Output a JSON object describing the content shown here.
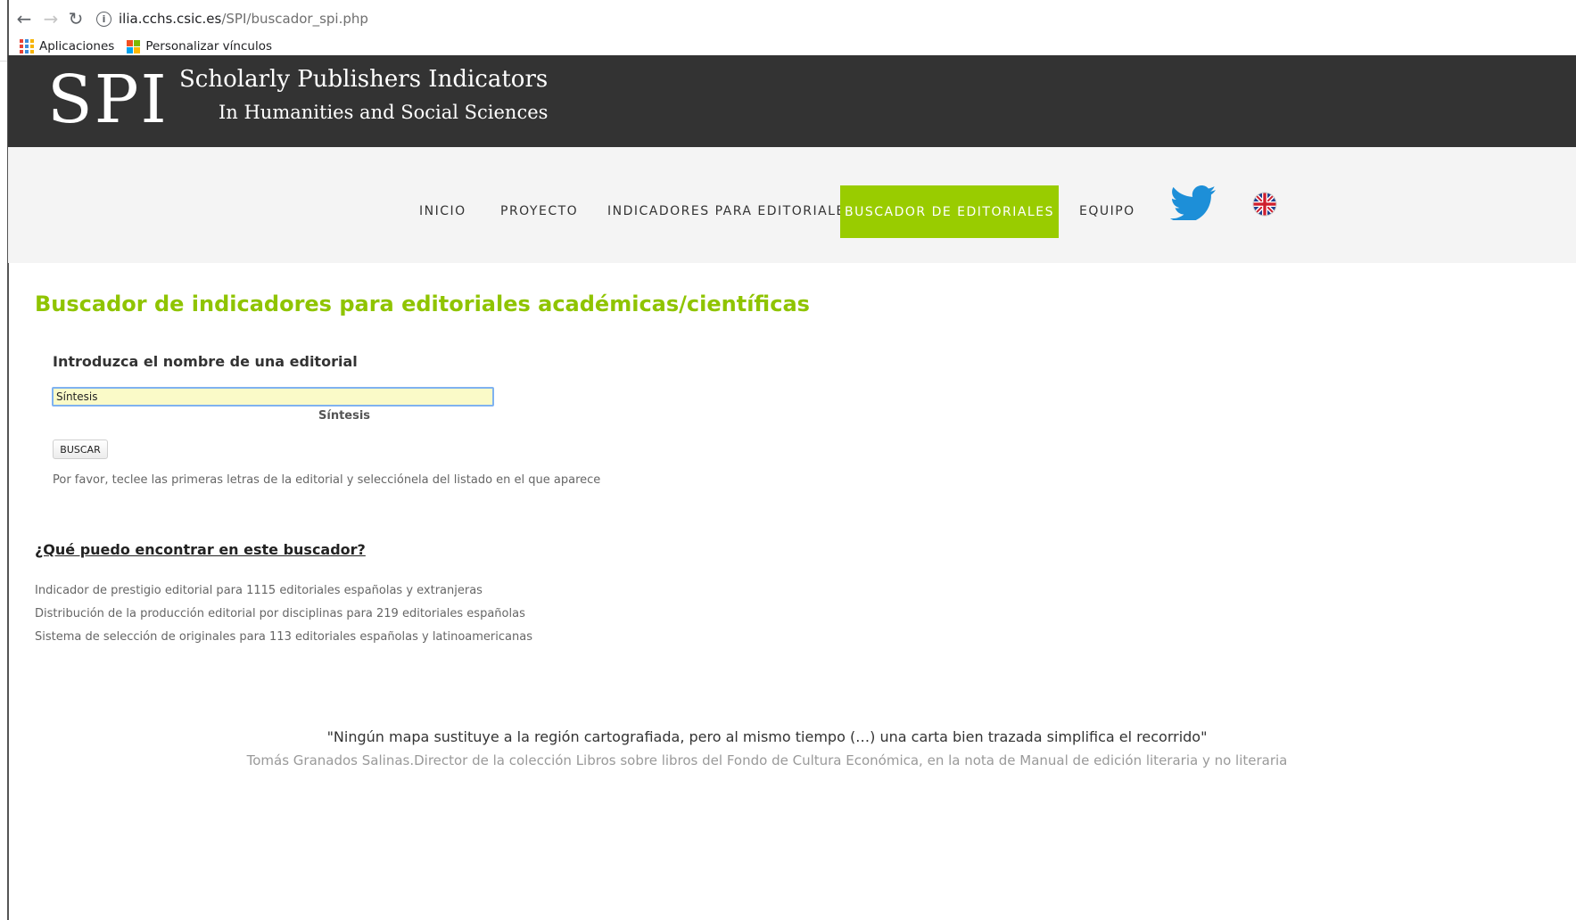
{
  "browser": {
    "back_icon": "←",
    "forward_icon": "→",
    "reload_icon": "↻",
    "info_icon": "i",
    "url_host": "ilia.cchs.csic.es",
    "url_path": "/SPI/buscador_spi.php",
    "bookmarks": [
      {
        "label": "Aplicaciones",
        "icon": "apps-grid-icon"
      },
      {
        "label": "Personalizar vínculos",
        "icon": "microsoft-logo-icon"
      }
    ]
  },
  "header": {
    "logo": "SPI",
    "title": "Scholarly Publishers Indicators",
    "subtitle": "In Humanities and Social Sciences"
  },
  "nav": {
    "items": [
      "INICIO",
      "PROYECTO",
      "INDICADORES PARA EDITORIALES",
      "BUSCADOR DE EDITORIALES",
      "EQUIPO"
    ],
    "active": "BUSCADOR DE EDITORIALES",
    "accent_color": "#99cc00",
    "icons": [
      "twitter-icon",
      "uk-flag-icon"
    ]
  },
  "main": {
    "title": "Buscador de indicadores para editoriales académicas/científicas",
    "field_label": "Introduzca el nombre de una editorial",
    "search_value": "Síntesis",
    "suggestion": "Síntesis",
    "button_label": "BUSCAR",
    "help_text": "Por favor, teclee las primeras letras de la editorial y selecciónela del listado en el que aparece",
    "faq_link": "¿Qué puedo encontrar en este buscador?",
    "features": [
      "Indicador de prestigio editorial para 1115 editoriales españolas y extranjeras",
      "Distribución de la producción editorial por disciplinas para 219 editoriales españolas",
      "Sistema de selección de originales para 113 editoriales españolas y latinoamericanas"
    ]
  },
  "quote": {
    "text": "\"Ningún mapa sustituye a la región cartografiada, pero al mismo tiempo (…) una carta bien trazada simplifica el recorrido\"",
    "author": "Tomás Granados Salinas.Director de la colección Libros sobre libros del Fondo de Cultura Económica, en la nota de Manual de edición literaria y no literaria"
  }
}
